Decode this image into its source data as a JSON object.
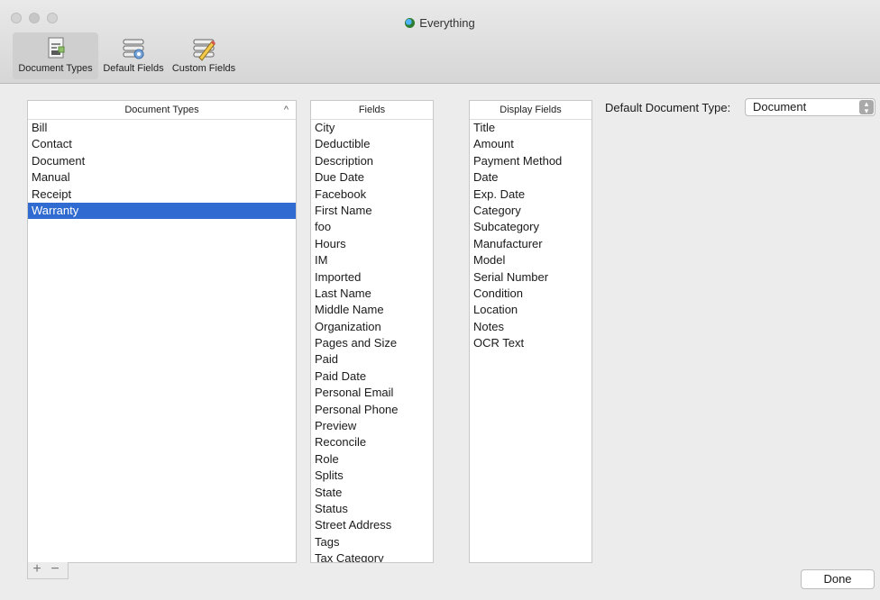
{
  "window": {
    "title": "Everything"
  },
  "toolbar": {
    "items": [
      {
        "label": "Document Types",
        "icon": "document-types-icon",
        "selected": true
      },
      {
        "label": "Default Fields",
        "icon": "default-fields-icon"
      },
      {
        "label": "Custom Fields",
        "icon": "custom-fields-icon"
      }
    ]
  },
  "doc_types": {
    "header": "Document Types",
    "sort_glyph": "^",
    "items": [
      "Bill",
      "Contact",
      "Document",
      "Manual",
      "Receipt",
      "Warranty"
    ],
    "selected": "Warranty"
  },
  "fields": {
    "header": "Fields",
    "items": [
      "City",
      "Deductible",
      "Description",
      "Due Date",
      "Facebook",
      "First Name",
      "foo",
      "Hours",
      "IM",
      "Imported",
      "Last Name",
      "Middle Name",
      "Organization",
      "Pages and Size",
      "Paid",
      "Paid Date",
      "Personal Email",
      "Personal Phone",
      "Preview",
      "Reconcile",
      "Role",
      "Splits",
      "State",
      "Status",
      "Street Address",
      "Tags",
      "Tax Category"
    ]
  },
  "display_fields": {
    "header": "Display Fields",
    "items": [
      "Title",
      "Amount",
      "Payment Method",
      "Date",
      "Exp. Date",
      "Category",
      "Subcategory",
      "Manufacturer",
      "Model",
      "Serial Number",
      "Condition",
      "Location",
      "Notes",
      "OCR Text"
    ]
  },
  "list_buttons": {
    "add": "+",
    "remove": "−"
  },
  "default_type": {
    "label": "Default Document Type:",
    "value": "Document",
    "stepper": "▴▾"
  },
  "done_label": "Done",
  "colors": {
    "selection": "#2f6bd0",
    "window_bg": "#ececec"
  }
}
